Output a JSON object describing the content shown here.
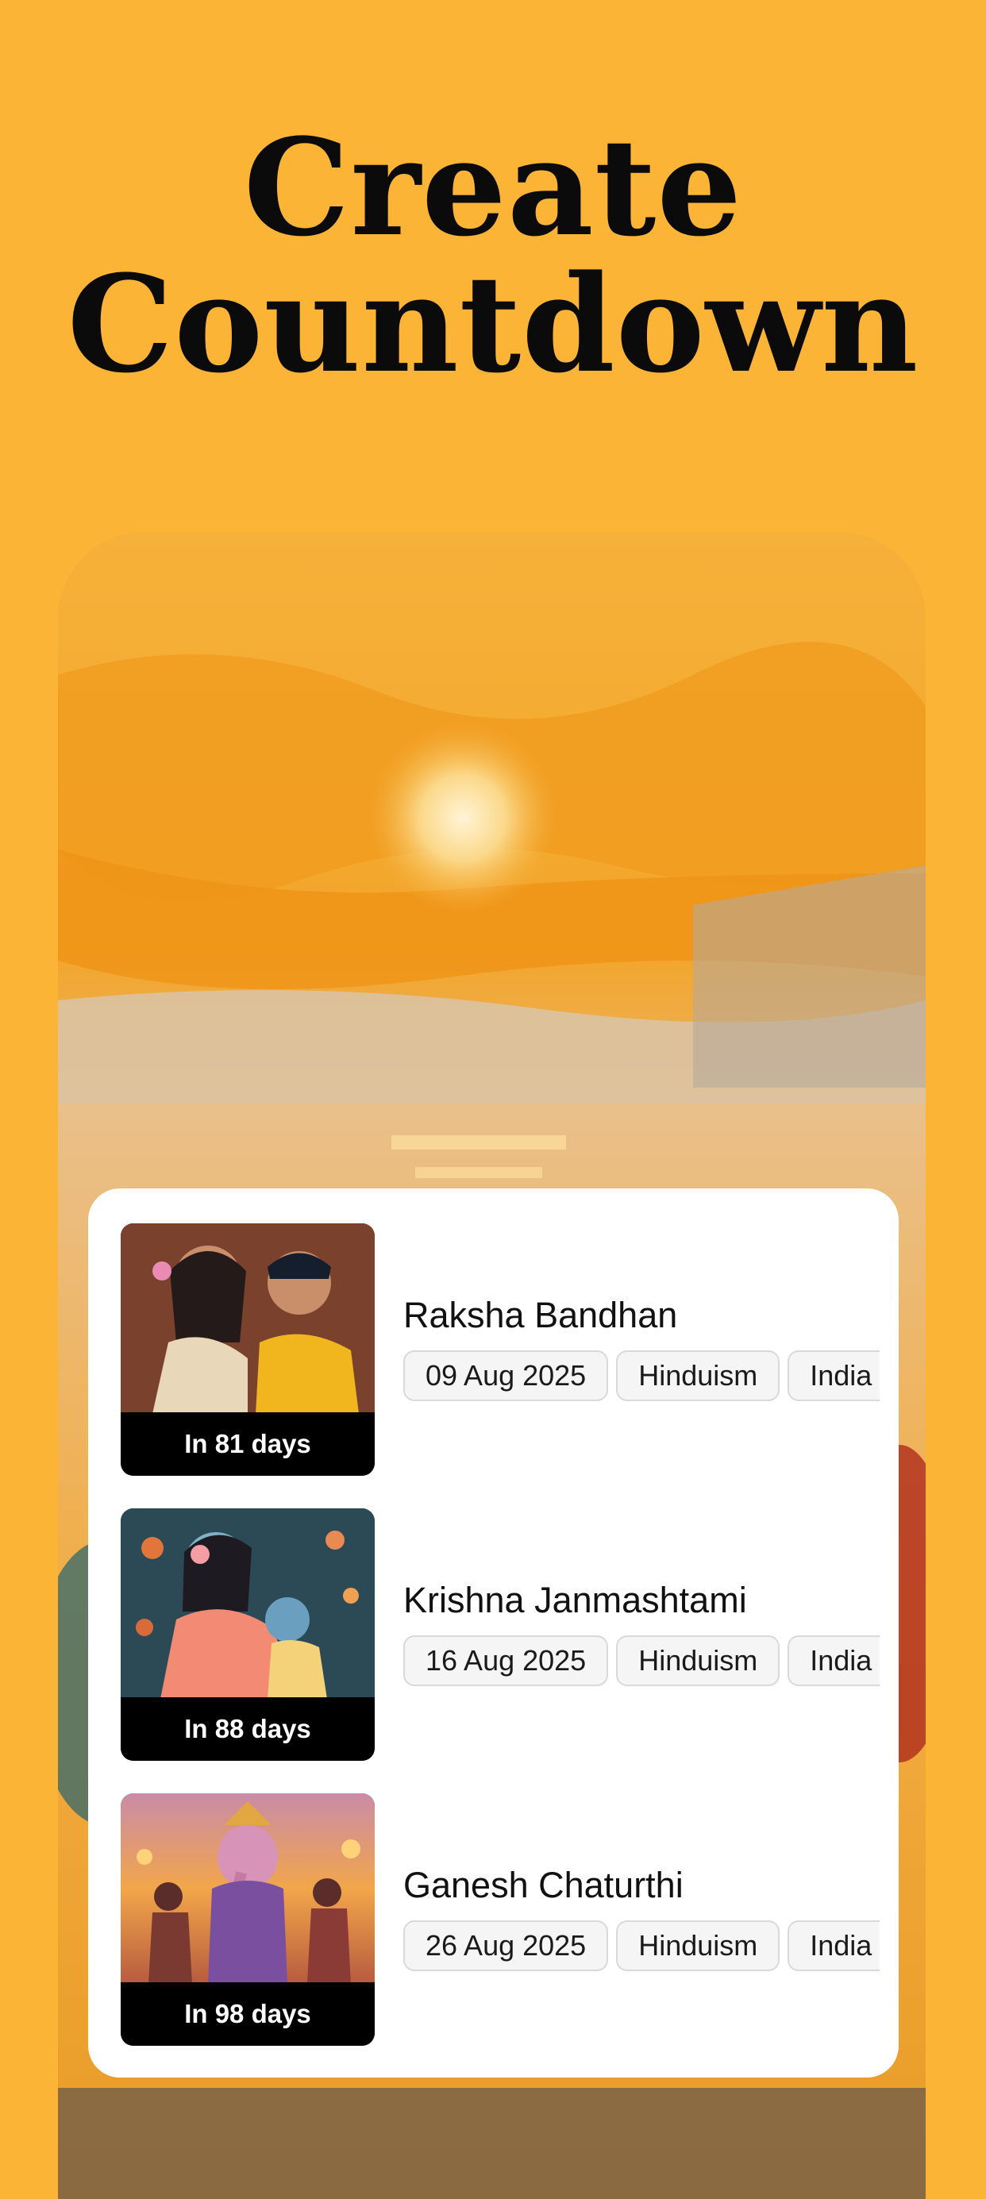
{
  "headline": {
    "line1": "Create",
    "line2": "Countdown"
  },
  "colors": {
    "background": "#FBB436",
    "card": "#FFFFFF",
    "tag_background": "#F5F5F5",
    "badge": "#000000"
  },
  "events": [
    {
      "title": "Raksha Bandhan",
      "countdown": "In 81 days",
      "tags": [
        "09 Aug 2025",
        "Hinduism",
        "India"
      ],
      "image": "raksha-bandhan-illustration"
    },
    {
      "title": "Krishna Janmashtami",
      "countdown": "In 88 days",
      "tags": [
        "16 Aug 2025",
        "Hinduism",
        "India"
      ],
      "image": "krishna-janmashtami-illustration"
    },
    {
      "title": "Ganesh Chaturthi",
      "countdown": "In 98 days",
      "tags": [
        "26 Aug 2025",
        "Hinduism",
        "India"
      ],
      "image": "ganesh-chaturthi-illustration"
    }
  ]
}
